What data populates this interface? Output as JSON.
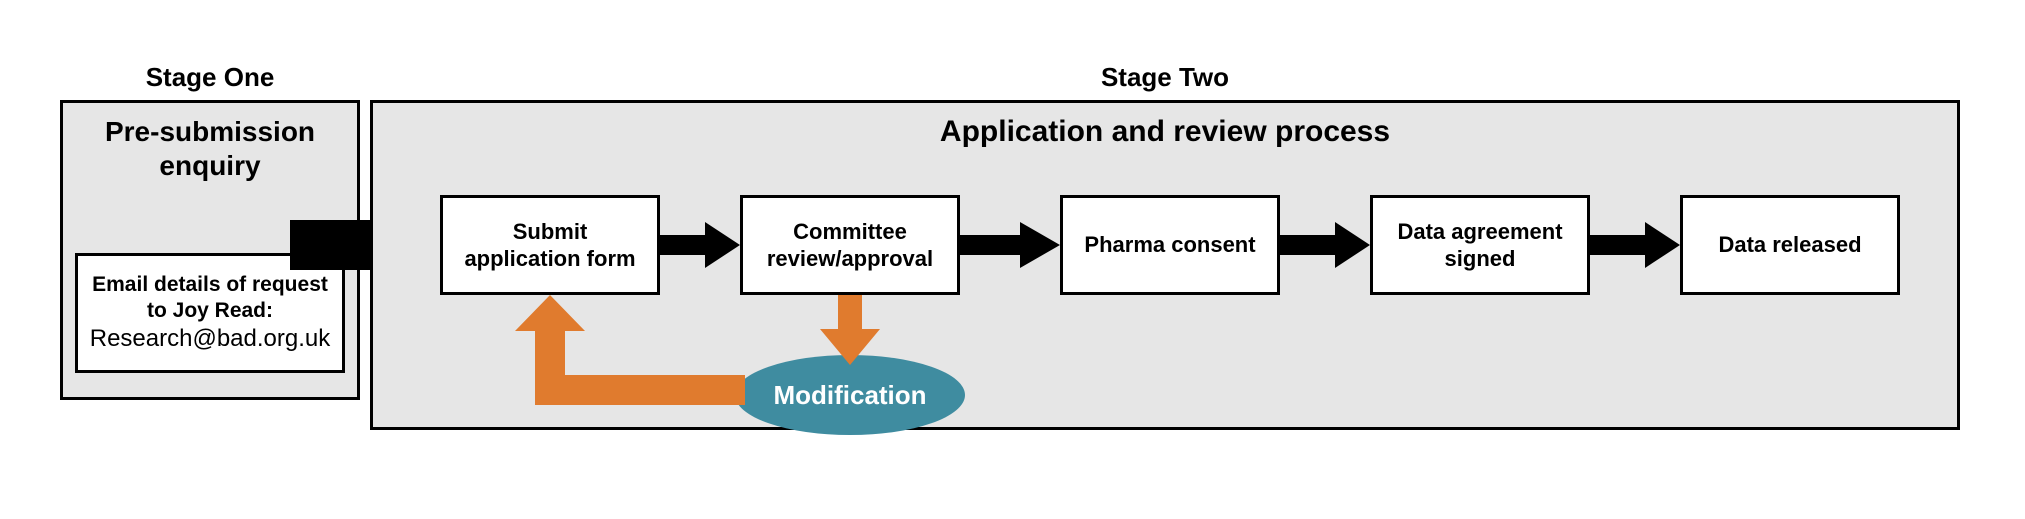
{
  "stage1": {
    "label": "Stage One",
    "title": "Pre-submission enquiry",
    "email_line1": "Email details of request",
    "email_line2": "to Joy Read:",
    "email_addr": "Research@bad.org.uk"
  },
  "stage2": {
    "label": "Stage Two",
    "title": "Application and review process",
    "steps": {
      "submit": "Submit application form",
      "committee": "Committee review/approval",
      "pharma": "Pharma consent",
      "agreement": "Data agreement signed",
      "released": "Data released"
    },
    "modification": "Modification"
  }
}
